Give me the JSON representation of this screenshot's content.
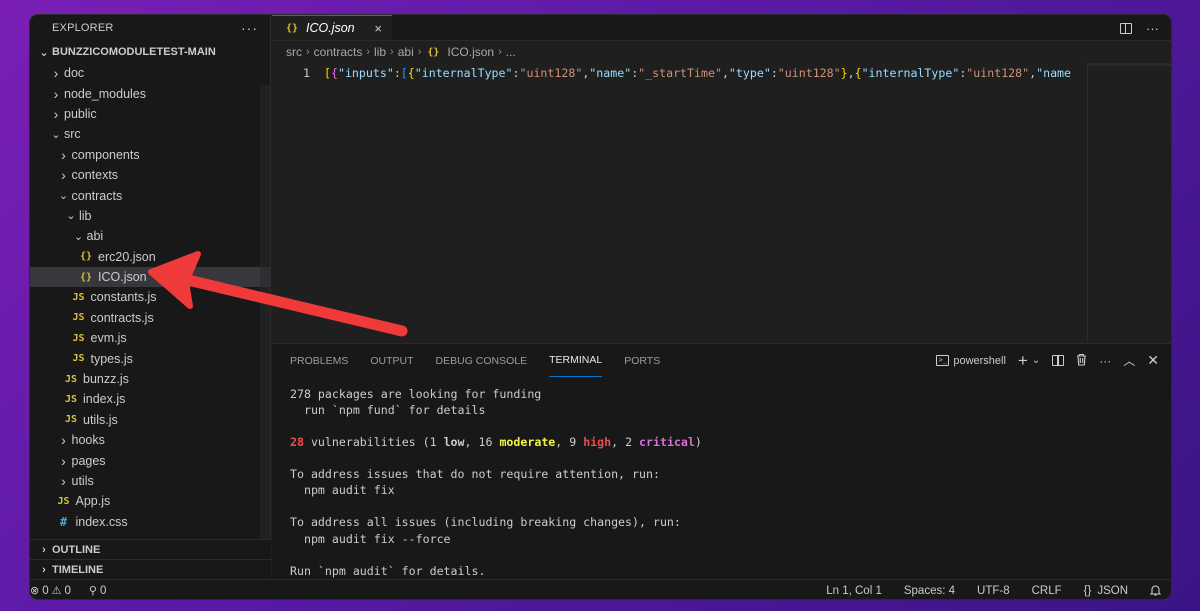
{
  "explorer": {
    "title": "EXPLORER",
    "more": "···",
    "root": "BUNZZICOMODULETEST-MAIN",
    "items": [
      {
        "label": "doc",
        "type": "folder",
        "open": false,
        "depth": 1
      },
      {
        "label": "node_modules",
        "type": "folder",
        "open": false,
        "depth": 1
      },
      {
        "label": "public",
        "type": "folder",
        "open": false,
        "depth": 1
      },
      {
        "label": "src",
        "type": "folder",
        "open": true,
        "depth": 1
      },
      {
        "label": "components",
        "type": "folder",
        "open": false,
        "depth": 2
      },
      {
        "label": "contexts",
        "type": "folder",
        "open": false,
        "depth": 2
      },
      {
        "label": "contracts",
        "type": "folder",
        "open": true,
        "depth": 2
      },
      {
        "label": "lib",
        "type": "folder",
        "open": true,
        "depth": 3
      },
      {
        "label": "abi",
        "type": "folder",
        "open": true,
        "depth": 4
      },
      {
        "label": "erc20.json",
        "type": "json",
        "depth": 5
      },
      {
        "label": "ICO.json",
        "type": "json",
        "depth": 5,
        "selected": true
      },
      {
        "label": "constants.js",
        "type": "js",
        "depth": 4
      },
      {
        "label": "contracts.js",
        "type": "js",
        "depth": 4
      },
      {
        "label": "evm.js",
        "type": "js",
        "depth": 4
      },
      {
        "label": "types.js",
        "type": "js",
        "depth": 4
      },
      {
        "label": "bunzz.js",
        "type": "js",
        "depth": 3
      },
      {
        "label": "index.js",
        "type": "js",
        "depth": 3
      },
      {
        "label": "utils.js",
        "type": "js",
        "depth": 3
      },
      {
        "label": "hooks",
        "type": "folder",
        "open": false,
        "depth": 2
      },
      {
        "label": "pages",
        "type": "folder",
        "open": false,
        "depth": 2
      },
      {
        "label": "utils",
        "type": "folder",
        "open": false,
        "depth": 2
      },
      {
        "label": "App.js",
        "type": "js",
        "depth": 2
      },
      {
        "label": "index.css",
        "type": "css",
        "depth": 2
      }
    ],
    "outline": "OUTLINE",
    "timeline": "TIMELINE"
  },
  "editor": {
    "tab": {
      "label": "ICO.json",
      "icon": "{}",
      "close": "×"
    },
    "breadcrumb": [
      "src",
      "contracts",
      "lib",
      "abi",
      "ICO.json",
      "..."
    ],
    "line_number": "1"
  },
  "panel": {
    "tabs": [
      "PROBLEMS",
      "OUTPUT",
      "DEBUG CONSOLE",
      "TERMINAL",
      "PORTS"
    ],
    "active_tab": "TERMINAL",
    "shell": "powershell"
  },
  "terminal": {
    "line1": "278 packages are looking for funding",
    "line2": "  run `npm fund` for details",
    "vuln_count": "28",
    "vuln_text": " vulnerabilities (1 ",
    "low": "low",
    "sep1": ", 16 ",
    "moderate": "moderate",
    "sep2": ", 9 ",
    "high": "high",
    "sep3": ", 2 ",
    "critical": "critical",
    "close": ")",
    "line4": "To address issues that do not require attention, run:",
    "line5": "  npm audit fix",
    "line6": "To address all issues (including breaking changes), run:",
    "line7": "  npm audit fix --force",
    "line8": "Run `npm audit` for details."
  },
  "status": {
    "errors": "0",
    "warnings": "0",
    "ports": "0",
    "position": "Ln 1, Col 1",
    "spaces": "Spaces: 4",
    "encoding": "UTF-8",
    "eol": "CRLF",
    "language": "JSON",
    "language_icon": "{}"
  },
  "colors": {
    "arrow": "#f03a3a",
    "accent": "#0078d4",
    "background_gradient": [
      "#7a1fb5",
      "#3a1585"
    ]
  }
}
